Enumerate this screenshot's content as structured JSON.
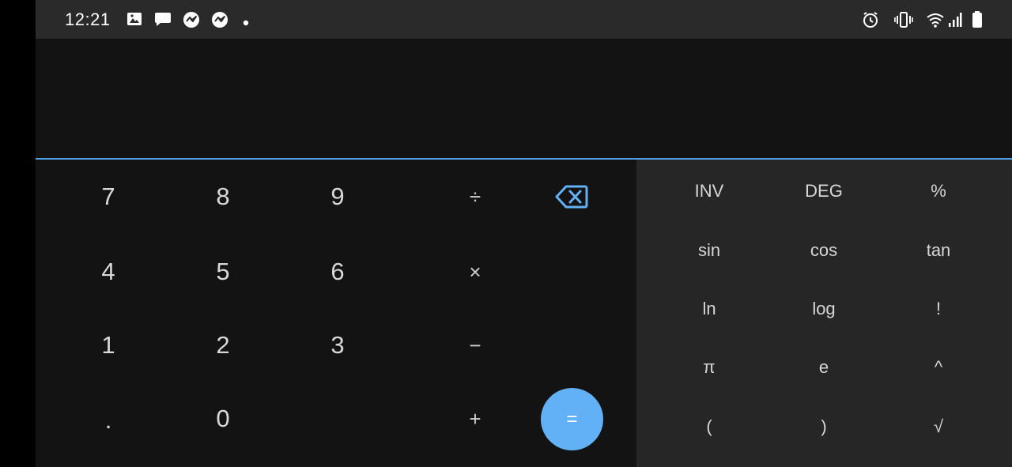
{
  "statusbar": {
    "time": "12:21",
    "left_icons": [
      "image-icon",
      "chat-bubble-icon",
      "messenger-icon",
      "messenger-icon",
      "dot-icon"
    ],
    "right_icons": [
      "alarm-icon",
      "vibrate-icon",
      "wifi-icon",
      "signal-icon",
      "battery-icon"
    ]
  },
  "display": {
    "accent_color": "#4f9ce6"
  },
  "numpad": {
    "digits": {
      "k7": "7",
      "k8": "8",
      "k9": "9",
      "k4": "4",
      "k5": "5",
      "k6": "6",
      "k1": "1",
      "k2": "2",
      "k3": "3",
      "dot": ".",
      "k0": "0"
    },
    "ops": {
      "divide": "÷",
      "multiply": "×",
      "minus": "−",
      "plus": "+",
      "equals": "="
    },
    "delete_icon": "backspace-icon",
    "equals_color": "#62b0f5"
  },
  "scientific": {
    "row1": [
      "INV",
      "DEG",
      "%"
    ],
    "row2": [
      "sin",
      "cos",
      "tan"
    ],
    "row3": [
      "ln",
      "log",
      "!"
    ],
    "row4": [
      "π",
      "e",
      "^"
    ],
    "row5": [
      "(",
      ")",
      "√"
    ]
  }
}
